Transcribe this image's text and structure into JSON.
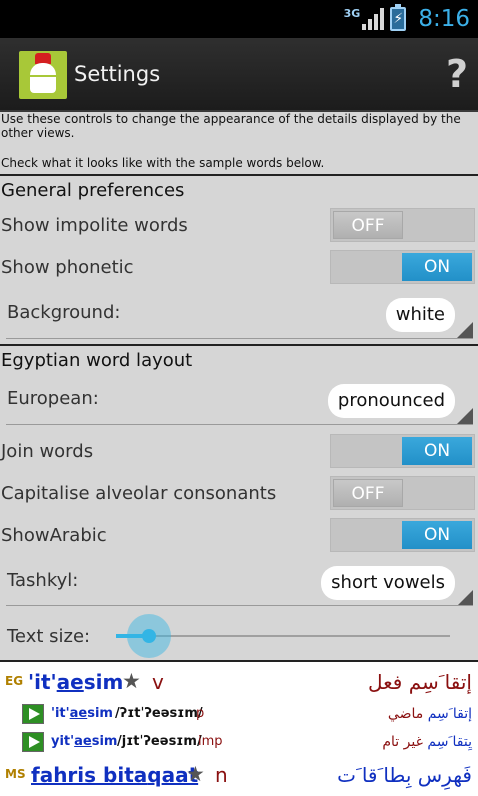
{
  "status_bar": {
    "network": "3G",
    "time": "8:16",
    "icons": [
      "signal-icon",
      "battery-charging-icon"
    ]
  },
  "action_bar": {
    "title": "Settings",
    "help": "?"
  },
  "intro": {
    "line1": "Use these controls to change the appearance of the details displayed by the other views.",
    "line2": "Check what it looks like with the sample words below."
  },
  "general": {
    "title": "General preferences",
    "impolite": {
      "label": "Show impolite words",
      "state": "OFF"
    },
    "phonetic": {
      "label": "Show phonetic",
      "state": "ON"
    },
    "background": {
      "label": "Background:",
      "value": "white"
    }
  },
  "egyptian": {
    "title": "Egyptian word layout",
    "european": {
      "label": "European:",
      "value": "pronounced"
    },
    "join": {
      "label": "Join words",
      "state": "ON"
    },
    "capitalise": {
      "label": "Capitalise alveolar consonants",
      "state": "OFF"
    },
    "arabic": {
      "label": "ShowArabic",
      "state": "ON"
    },
    "tashkyl": {
      "label": "Tashkyl:",
      "value": "short vowels"
    },
    "text_size": {
      "label": "Text size:",
      "level": 0.1
    }
  },
  "samples": {
    "eg": {
      "badge": "EG",
      "word_pre": "'it'",
      "word_u": "ae",
      "word_post": "sim",
      "star": "★",
      "pos": "v",
      "arabic": "إتقا َسِم فعل",
      "forms": [
        {
          "word_pre": "'it'",
          "word_u": "ae",
          "word_post": "sim",
          "phonetic": "/ʔɪtˈʔeəsɪm/",
          "pos": "p",
          "arabic_main": "إتقا َسِم",
          "arabic_note": "ماضي"
        },
        {
          "word_pre": "yit'",
          "word_u": "ae",
          "word_post": "sim",
          "phonetic": "/jɪtˈʔeəsɪm/",
          "pos": "imp",
          "arabic_main": "يِتقا َسِم",
          "arabic_note": "غير تام"
        }
      ]
    },
    "ms": {
      "badge": "MS",
      "word_pre": "fahris bita",
      "word_u": "q",
      "word_post": "aat",
      "star": "★",
      "pos": "n",
      "arabic": "فَهرِس بِطا َقا َت"
    }
  },
  "colors": {
    "accent": "#33b5e5",
    "word": "#1030c0",
    "arabic": "#8a1010",
    "badge": "#b08000",
    "play": "#2e8f24"
  }
}
